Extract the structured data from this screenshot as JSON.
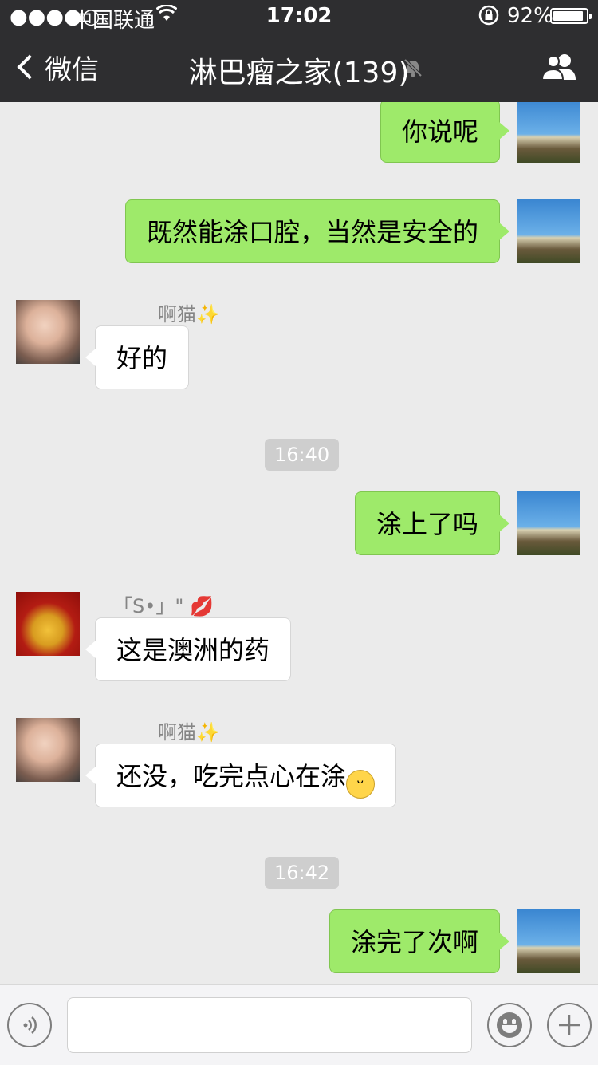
{
  "status_bar": {
    "signal": "●●●●○",
    "carrier": "中国联通",
    "wifi_icon": "wifi-icon",
    "time": "17:02",
    "lock_icon": "rotation-lock-icon",
    "battery_percent": "92%",
    "battery_level": 0.92
  },
  "nav": {
    "back_label": "微信",
    "title": "淋巴瘤之家(139)",
    "mute_icon": "bell-muted-icon",
    "group_icon": "group-members-icon"
  },
  "messages": [
    {
      "side": "out",
      "text": "你说呢"
    },
    {
      "side": "out",
      "text": "既然能涂口腔，当然是安全的"
    },
    {
      "side": "in",
      "sender": "啊猫",
      "sender_suffix": "✨",
      "text": "好的"
    },
    {
      "timestamp": "16:40"
    },
    {
      "side": "out",
      "text": "涂上了吗"
    },
    {
      "side": "in",
      "sender": "「S•」\"",
      "sender_suffix": "💋",
      "text": "这是澳洲的药"
    },
    {
      "side": "in",
      "sender": "啊猫",
      "sender_suffix": "✨",
      "text": "还没，吃完点心在涂",
      "emoji": "😁"
    },
    {
      "timestamp": "16:42"
    },
    {
      "side": "out",
      "text": "涂完了次啊"
    }
  ],
  "input_bar": {
    "voice_icon": "voice-icon",
    "emoji_icon": "emoji-icon",
    "plus_icon": "plus-icon",
    "placeholder": ""
  },
  "colors": {
    "nav_bg": "#2e2e30",
    "chat_bg": "#ebebeb",
    "outgoing_bubble": "#9eea6a",
    "incoming_bubble": "#ffffff"
  }
}
